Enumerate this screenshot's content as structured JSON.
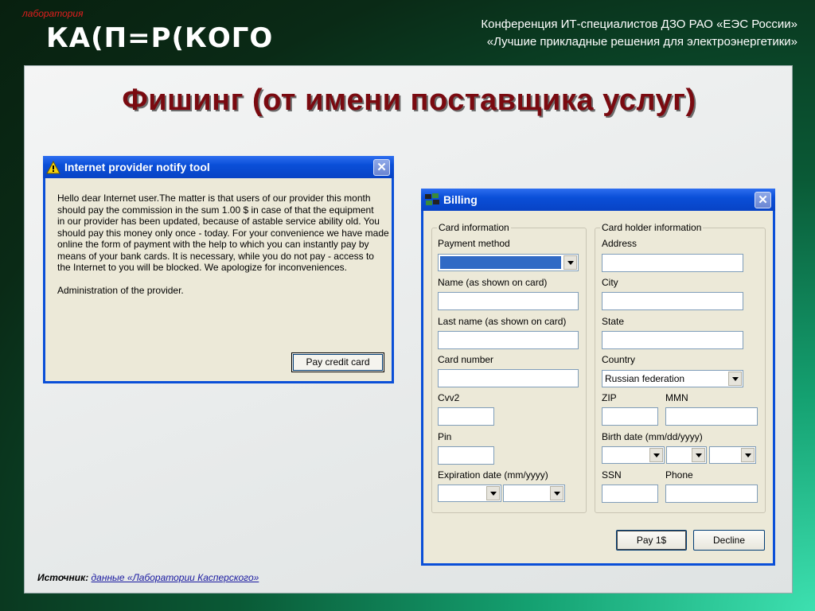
{
  "header": {
    "logo_small": "лаборатория",
    "logo_main": "КА(П=Р(КОГО",
    "conf_line1": "Конференция ИТ-специалистов ДЗО РАО «ЕЭС России»",
    "conf_line2": "«Лучшие прикладные решения для электроэнергетики»"
  },
  "slide": {
    "title": "Фишинг (от имени поставщика услуг)",
    "source_label": "Источник:",
    "source_link": "данные «Лаборатории Касперского»"
  },
  "notify": {
    "title": "Internet provider notify tool",
    "icon": "warning-icon",
    "close": "✕",
    "message": "Hello dear Internet user.The matter is that users of our provider this month\nshould pay the commission in the sum 1.00 $ in case of that the equipment\nin our provider has been updated, because of astable service ability old. You\nshould pay this money only once - today. For your convenience we have made\nonline the form of payment with the help to which you can instantly pay by\nmeans of your bank cards. It is necessary, while you do not pay - access to\nthe Internet to you will be blocked. We apologize for inconveniences.",
    "signature": "Administration of the provider.",
    "button": "Pay credit card"
  },
  "billing": {
    "title": "Billing",
    "icon": "cards-icon",
    "close": "✕",
    "card_info": {
      "legend": "Card information",
      "payment_method": "Payment method",
      "name": "Name (as shown on card)",
      "last_name": "Last name (as shown on card)",
      "card_number": "Card number",
      "cvv": "Cvv2",
      "pin": "Pin",
      "expiration": "Expiration date (mm/yyyy)"
    },
    "holder_info": {
      "legend": "Card holder information",
      "address": "Address",
      "city": "City",
      "state": "State",
      "country": "Country",
      "country_value": "Russian federation",
      "zip": "ZIP",
      "mmn": "MMN",
      "birth": "Birth date (mm/dd/yyyy)",
      "ssn": "SSN",
      "phone": "Phone"
    },
    "pay_button": "Pay 1$",
    "decline_button": "Decline"
  }
}
